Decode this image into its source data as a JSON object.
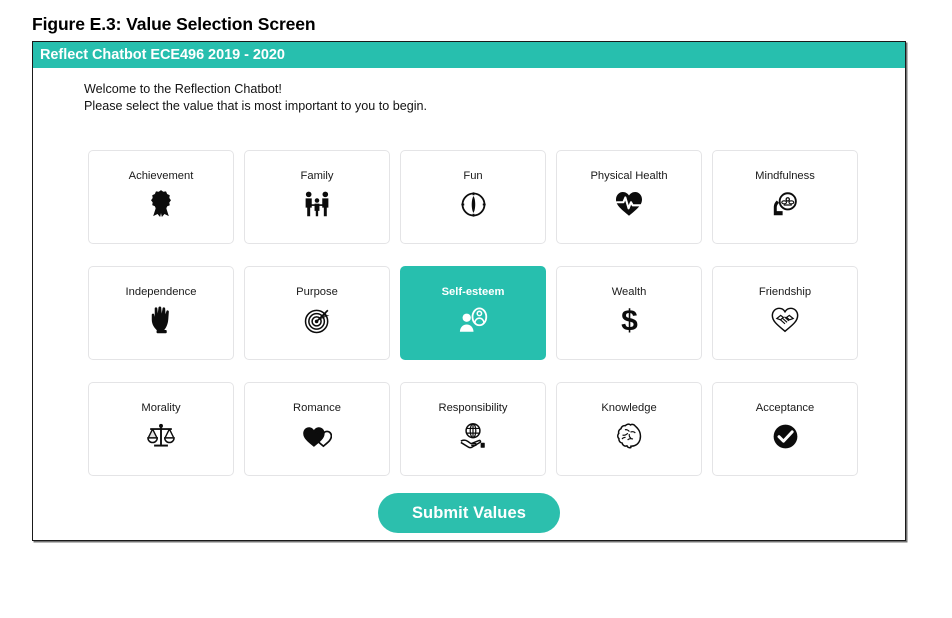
{
  "figure": {
    "caption": "Figure E.3: Value Selection Screen"
  },
  "colors": {
    "accent_teal": "#27bfae",
    "button_teal": "#2cbfad",
    "card_border": "#e4e4e6",
    "frame_border": "#1a1a1a",
    "card_text": "#1a1a1a",
    "selected_text": "#ffffff"
  },
  "window": {
    "header_title": "Reflect Chatbot ECE496 2019 - 2020"
  },
  "intro": {
    "line1": "Welcome to the Reflection Chatbot!",
    "line2": "Please select the value that is most important to you to begin."
  },
  "values": [
    {
      "label": "Achievement",
      "icon": "award-ribbon-icon",
      "selected": false
    },
    {
      "label": "Family",
      "icon": "family-people-icon",
      "selected": false
    },
    {
      "label": "Fun",
      "icon": "compass-icon",
      "selected": false
    },
    {
      "label": "Physical Health",
      "icon": "heart-pulse-icon",
      "selected": false
    },
    {
      "label": "Mindfulness",
      "icon": "head-meditation-icon",
      "selected": false
    },
    {
      "label": "Independence",
      "icon": "raised-fist-icon",
      "selected": false
    },
    {
      "label": "Purpose",
      "icon": "target-dart-icon",
      "selected": false
    },
    {
      "label": "Self-esteem",
      "icon": "person-mirror-icon",
      "selected": true
    },
    {
      "label": "Wealth",
      "icon": "dollar-sign-icon",
      "selected": false
    },
    {
      "label": "Friendship",
      "icon": "heart-handshake-icon",
      "selected": false
    },
    {
      "label": "Morality",
      "icon": "balance-scales-icon",
      "selected": false
    },
    {
      "label": "Romance",
      "icon": "two-hearts-icon",
      "selected": false
    },
    {
      "label": "Responsibility",
      "icon": "globe-in-hand-icon",
      "selected": false
    },
    {
      "label": "Knowledge",
      "icon": "brain-icon",
      "selected": false
    },
    {
      "label": "Acceptance",
      "icon": "check-circle-icon",
      "selected": false
    }
  ],
  "submit": {
    "label": "Submit Values"
  }
}
